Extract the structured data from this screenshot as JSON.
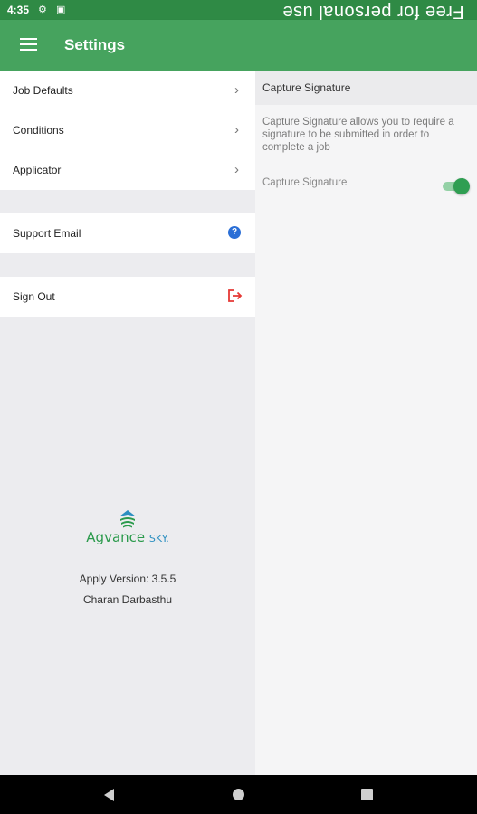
{
  "status_bar": {
    "time": "4:35",
    "watermark": "Free for personal use",
    "icons": [
      "settings-gear-icon",
      "sd-card-icon",
      "wifi-icon",
      "signal-icon",
      "battery-icon"
    ]
  },
  "app_bar": {
    "title": "Settings",
    "menu_icon": "hamburger-menu-icon",
    "color": "#46a35e"
  },
  "settings_list": {
    "group1": [
      {
        "label": "Job Defaults",
        "chevron": "›"
      },
      {
        "label": "Conditions",
        "chevron": "›"
      },
      {
        "label": "Applicator",
        "chevron": "›"
      }
    ],
    "support": {
      "label": "Support Email",
      "icon": "help-circle-icon",
      "glyph": "?"
    },
    "signout": {
      "label": "Sign Out",
      "icon": "sign-out-icon"
    }
  },
  "footer": {
    "logo_text": "Agvance",
    "logo_sky": "SKY.",
    "version": "Apply Version: 3.5.5",
    "user": "Charan Darbasthu"
  },
  "detail": {
    "header": "Capture Signature",
    "description": "Capture Signature allows you to require a signature to be submitted in order to complete a job",
    "option_label": "Capture Signature",
    "option_enabled": true
  },
  "nav_bar": {
    "icons": [
      "back-icon",
      "home-icon",
      "recents-icon"
    ]
  },
  "colors": {
    "primary": "#46a35e",
    "status_bar": "#2f8a45",
    "help_blue": "#2b6fd6",
    "signout_red": "#e53935"
  }
}
